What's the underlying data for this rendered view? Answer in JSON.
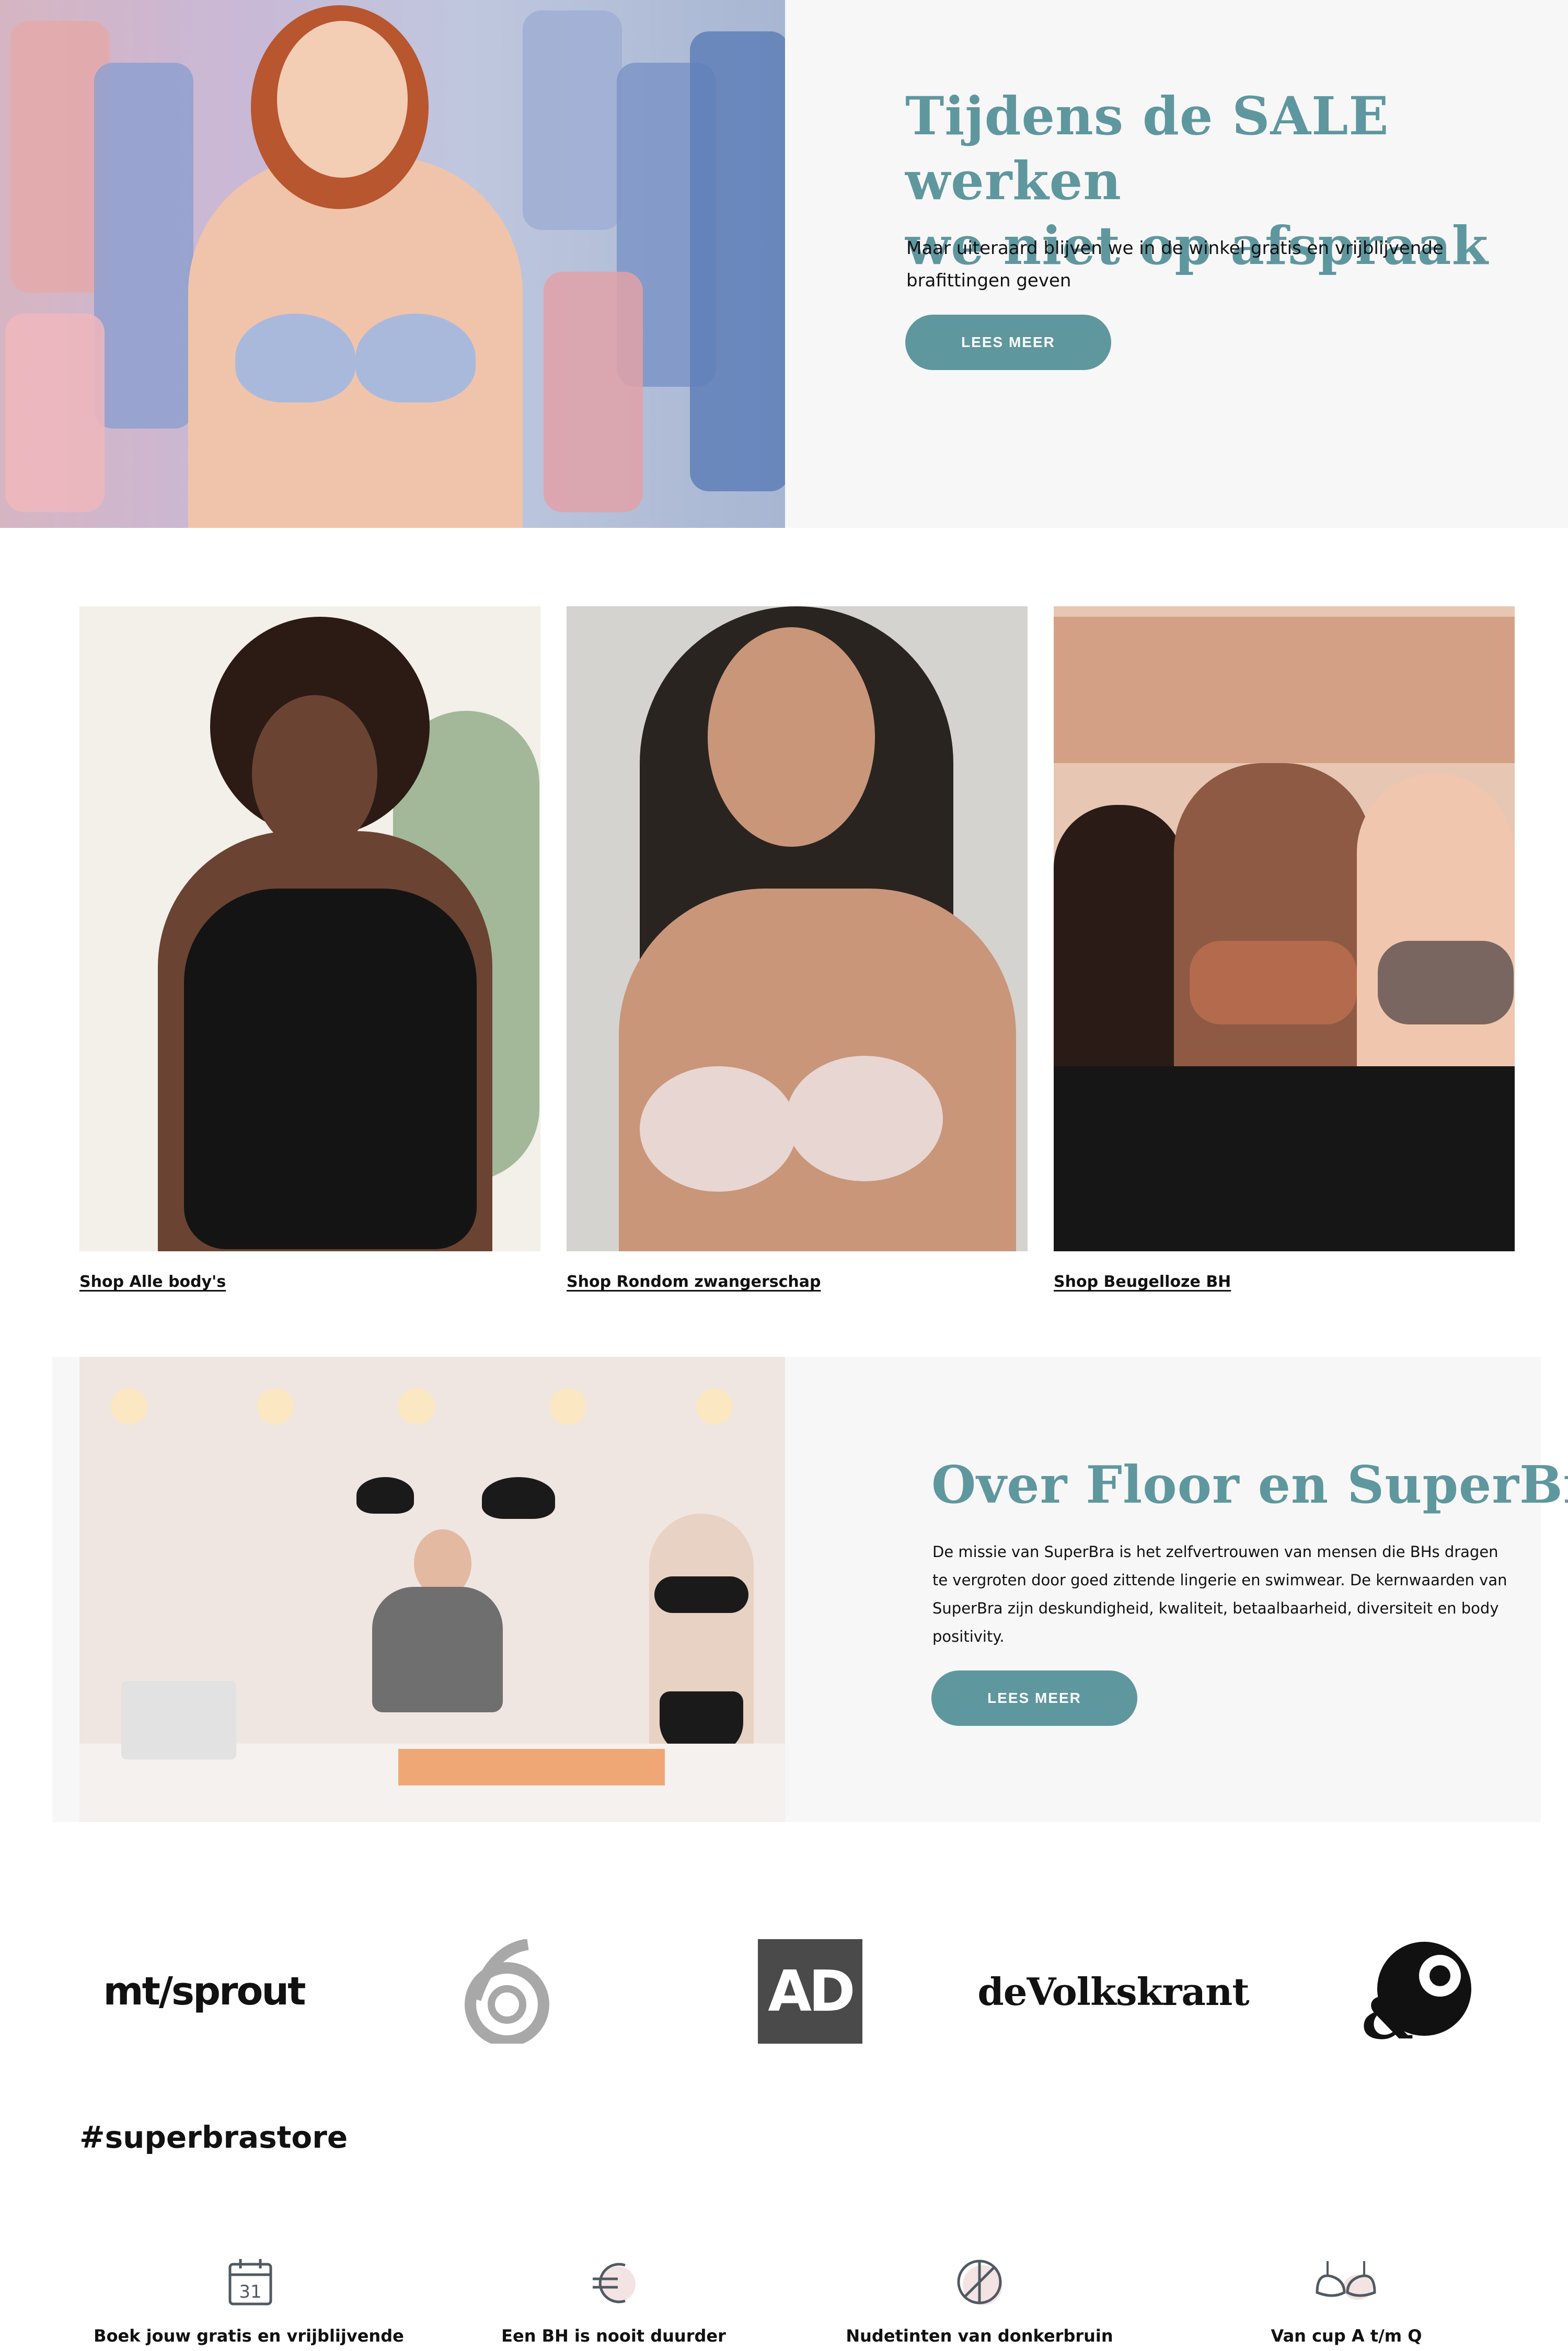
{
  "hero": {
    "title_line1": "Tijdens de SALE werken",
    "title_line2": "we niet op afspraak",
    "text_line1": "Maar uiteraard blijven we in de winkel gratis en vrijblijvende",
    "text_line2": "brafittingen geven",
    "cta": "LEES MEER"
  },
  "categories": [
    {
      "label": "Shop Alle body's"
    },
    {
      "label": "Shop Rondom zwangerschap"
    },
    {
      "label": "Shop Beugelloze BH"
    }
  ],
  "about": {
    "title": "Over Floor en SuperBra",
    "text_line1": "De missie van SuperBra is het zelfvertrouwen van mensen die BHs dragen",
    "text_line2": "te vergroten door goed zittende lingerie en swimwear. De kernwaarden van",
    "text_line3": "SuperBra zijn deskundigheid, kwaliteit, betaalbaarheid, diversiteit en body",
    "text_line4": "positivity.",
    "cta": "LEES MEER"
  },
  "press": {
    "logos": [
      {
        "name": "mt/sprout",
        "text": "mt/sprout"
      },
      {
        "name": "6",
        "text": "6"
      },
      {
        "name": "AD",
        "text": "AD"
      },
      {
        "name": "de Volkskrant",
        "text": "deVolkskrant"
      },
      {
        "name": "&C",
        "text": "&C"
      }
    ]
  },
  "hashtag": "#superbrastore",
  "usps": [
    {
      "icon": "calendar-icon",
      "calendar_day": "31",
      "label": "Boek jouw gratis en vrijblijvende"
    },
    {
      "icon": "euro-icon",
      "label": "Een BH is nooit duurder"
    },
    {
      "icon": "nude-tones-icon",
      "label": "Nudetinten van donkerbruin"
    },
    {
      "icon": "bra-icon",
      "label": "Van cup A t/m Q"
    }
  ],
  "colors": {
    "accent": "#5f979f",
    "panel_bg": "#f7f7f7",
    "text": "#111111"
  }
}
